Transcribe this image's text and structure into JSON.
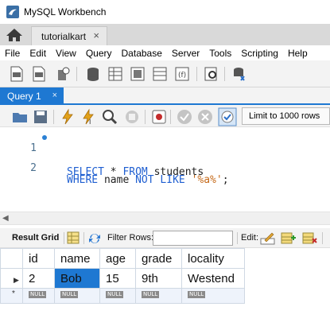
{
  "window": {
    "title": "MySQL Workbench"
  },
  "connection_tab": {
    "label": "tutorialkart",
    "close": "×"
  },
  "menu": [
    "File",
    "Edit",
    "View",
    "Query",
    "Database",
    "Server",
    "Tools",
    "Scripting",
    "Help"
  ],
  "query_tab": {
    "label": "Query 1",
    "close": "×"
  },
  "sql_toolbar": {
    "limit_label": "Limit to 1000 rows"
  },
  "editor": {
    "lines": [
      {
        "number": "1",
        "tokens": [
          "SELECT",
          " * ",
          "FROM",
          " students"
        ]
      },
      {
        "number": "2",
        "tokens": [
          "WHERE",
          " name ",
          "NOT",
          " ",
          "LIKE",
          " ",
          "'%a%'",
          ";"
        ]
      }
    ]
  },
  "result_toolbar": {
    "result_grid_label": "Result Grid",
    "filter_label": "Filter Rows:",
    "filter_value": "",
    "edit_label": "Edit:"
  },
  "result_grid": {
    "columns": [
      "id",
      "name",
      "age",
      "grade",
      "locality"
    ],
    "rows": [
      [
        "2",
        "Bob",
        "15",
        "9th",
        "Westend"
      ]
    ],
    "selected_cell": {
      "row": 0,
      "column": 1
    },
    "new_row_marker": "*",
    "null_label": "NULL"
  },
  "colors": {
    "accent": "#1e78d2",
    "keyword": "#1f5fd1",
    "string": "#c66a1a",
    "line_number": "#4a6f8e"
  },
  "icons": {
    "app": "mysql-workbench-dolphin-icon",
    "home": "home-icon"
  }
}
